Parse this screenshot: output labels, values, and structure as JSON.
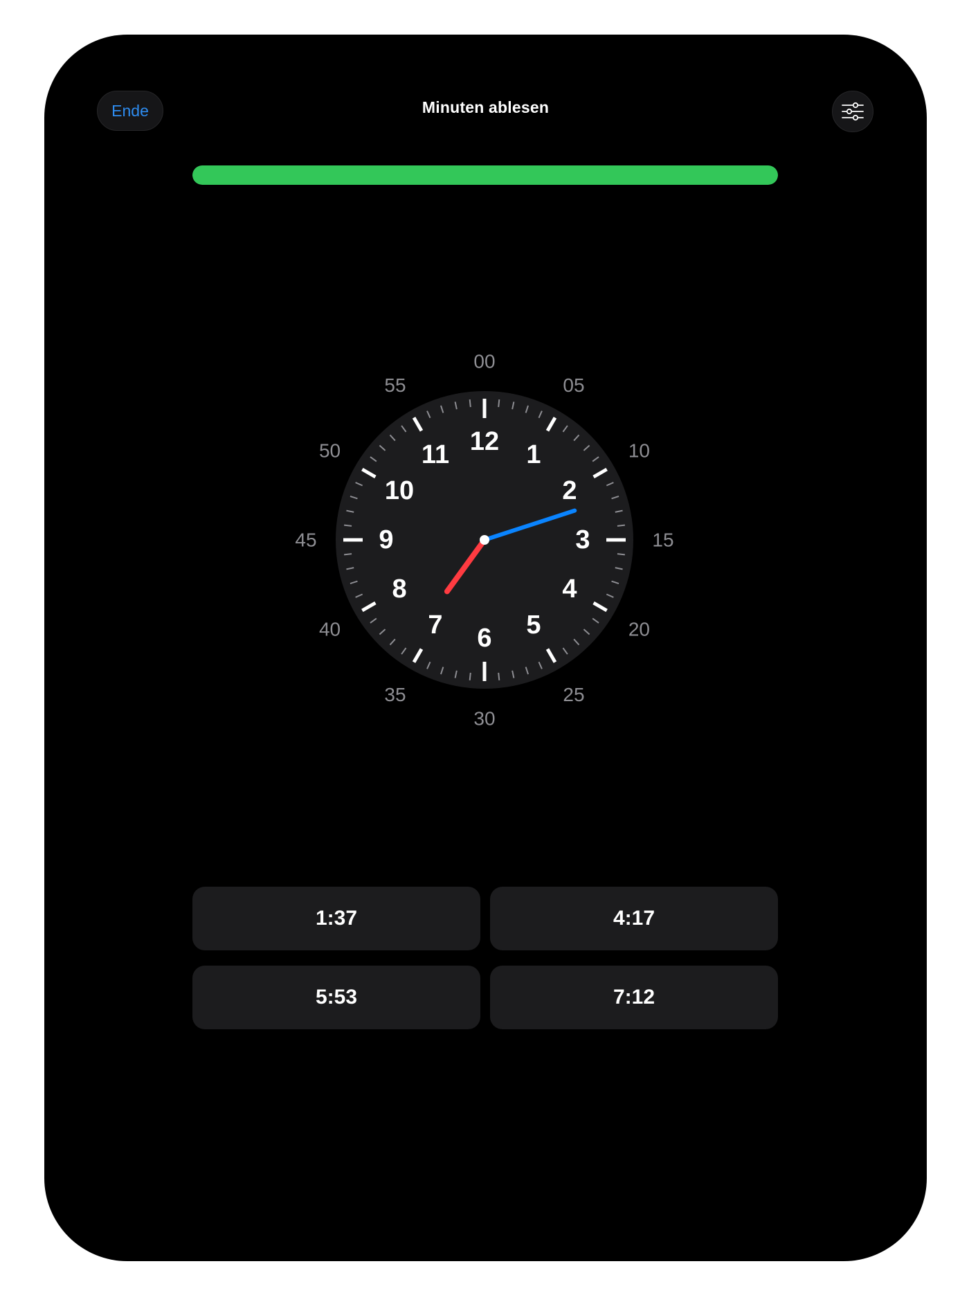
{
  "header": {
    "end_label": "Ende",
    "title": "Minuten ablesen",
    "settings_icon": "sliders-icon"
  },
  "progress": {
    "value": 1.0,
    "color": "#33c759"
  },
  "clock": {
    "hour_numbers": [
      "12",
      "1",
      "2",
      "3",
      "4",
      "5",
      "6",
      "7",
      "8",
      "9",
      "10",
      "11"
    ],
    "minute_labels": [
      "00",
      "05",
      "10",
      "15",
      "20",
      "25",
      "30",
      "35",
      "40",
      "45",
      "50",
      "55"
    ],
    "time": {
      "hour": 7,
      "minute": 12
    },
    "hour_hand_color": "#ff3b41",
    "minute_hand_color": "#0a84ff",
    "face_color": "#1c1c1e"
  },
  "answers": [
    "1:37",
    "4:17",
    "5:53",
    "7:12"
  ]
}
